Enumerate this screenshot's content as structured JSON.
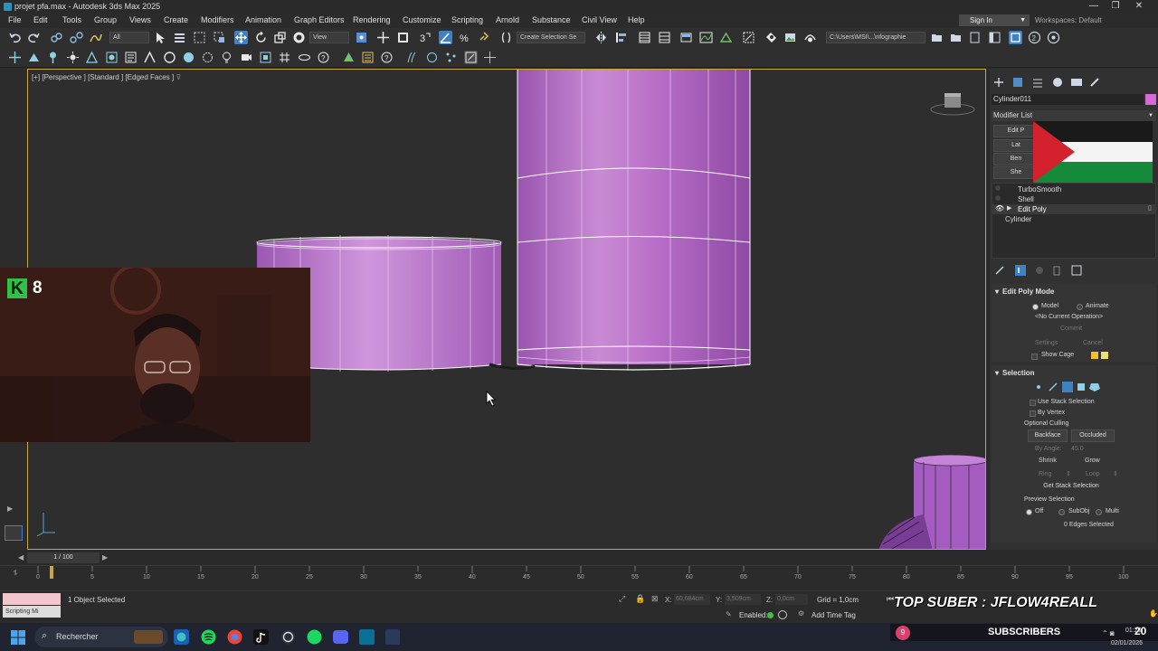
{
  "window": {
    "title": "projet pfa.max - Autodesk 3ds Max 2025",
    "controls": [
      "—",
      "❐",
      "✕"
    ]
  },
  "menu": [
    "File",
    "Edit",
    "Tools",
    "Group",
    "Views",
    "Create",
    "Modifiers",
    "Animation",
    "Graph Editors",
    "Rendering",
    "Customize",
    "Scripting",
    "Arnold",
    "Substance",
    "Civil View",
    "Help"
  ],
  "account": {
    "sign_in": "Sign In",
    "workspaces_label": "Workspaces: Default"
  },
  "toolbar": {
    "filter_value": "All",
    "refcoord_value": "View",
    "selection_set_value": "Create Selection Se",
    "project_path": "C:\\Users\\MSI\\...\\nfographie"
  },
  "viewport": {
    "label": "[+] [Perspective ] [Standard ] [Edged Faces ]",
    "label_parts": [
      "[+]",
      "[Perspective ]",
      "[Standard ]",
      "[Edged Faces ]"
    ]
  },
  "webcam": {
    "badge_k": "K",
    "badge_count": "8"
  },
  "command_panel": {
    "object_name": "Cylinder011",
    "object_color": "#d86ad8",
    "modifier_list_label": "Modifier List",
    "modifier_buttons": [
      "Edit P",
      "Lat",
      "Ben",
      "She"
    ],
    "stack": [
      {
        "name": "TurboSmooth",
        "active": false
      },
      {
        "name": "Shell",
        "active": false
      },
      {
        "name": "Edit Poly",
        "active": true
      },
      {
        "name": "Cylinder",
        "active": false
      }
    ],
    "edit_poly_mode": {
      "title": "Edit Poly Mode",
      "model": "Model",
      "animate": "Animate",
      "current_op": "<No Current Operation>",
      "commit": "Commit",
      "settings": "Settings",
      "cancel": "Cancel",
      "show_cage": "Show Cage"
    },
    "selection": {
      "title": "Selection",
      "use_stack": "Use Stack Selection",
      "by_vertex": "By Vertex",
      "optional_culling": "Optional Culling",
      "backface": "Backface",
      "occluded": "Occluded",
      "by_angle": "By Angle:",
      "angle_value": "45.0",
      "shrink": "Shrink",
      "grow": "Grow",
      "ring": "Ring",
      "loop": "Loop",
      "get_stack": "Get Stack Selection",
      "preview_selection": "Preview Selection",
      "off": "Off",
      "subobj": "SubObj",
      "multi": "Multi",
      "status": "0 Edges Selected"
    }
  },
  "timeline": {
    "frame_readout": "1 / 100",
    "ticks": [
      "0",
      "5",
      "10",
      "15",
      "20",
      "25",
      "30",
      "35",
      "40",
      "45",
      "50",
      "55",
      "60",
      "65",
      "70",
      "75",
      "80",
      "85",
      "90",
      "95",
      "100"
    ]
  },
  "status": {
    "maxscript": "Scripting Mi",
    "selected": "1 Object Selected",
    "x_label": "X:",
    "x_value": "60,684cm",
    "y_label": "Y:",
    "y_value": "3,509cm",
    "z_label": "Z:",
    "z_value": "0,0cm",
    "grid": "Grid = 1,0cm",
    "enabled": "Enabled:",
    "add_time_tag": "Add Time Tag"
  },
  "stream_overlay": {
    "top_suber": "TOP SUBER : JFLOW4REALL",
    "subscribers": "SUBSCRIBERS",
    "sub_count": "9"
  },
  "taskbar": {
    "search_placeholder": "Rechercher",
    "time": "01:20",
    "date": "02/01/2026"
  },
  "colors": {
    "accent_blue": "#3f82c4",
    "cylinder_purple": "#b46bc4",
    "viewport_border": "#c8a640"
  }
}
